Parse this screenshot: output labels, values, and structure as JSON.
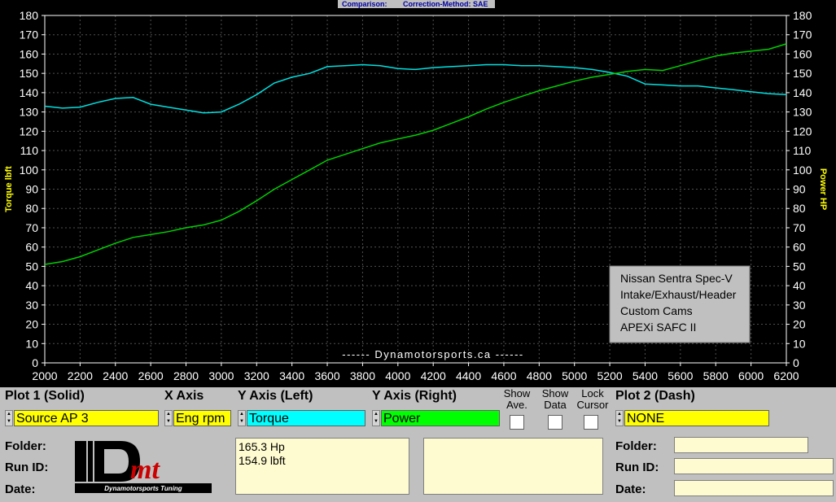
{
  "header": {
    "comparison_label": "Comparison:",
    "correction_label": "Correction-Method: SAE"
  },
  "chart_data": {
    "type": "line",
    "x": [
      2000,
      2100,
      2200,
      2300,
      2400,
      2500,
      2600,
      2700,
      2800,
      2900,
      3000,
      3100,
      3200,
      3300,
      3400,
      3500,
      3600,
      3700,
      3800,
      3900,
      4000,
      4100,
      4200,
      4300,
      4400,
      4500,
      4600,
      4700,
      4800,
      4900,
      5000,
      5100,
      5200,
      5300,
      5400,
      5500,
      5600,
      5700,
      5800,
      5900,
      6000,
      6100,
      6200
    ],
    "xlim": [
      2000,
      6200
    ],
    "ylim": [
      0,
      180
    ],
    "xticks": [
      2000,
      2200,
      2400,
      2600,
      2800,
      3000,
      3200,
      3400,
      3600,
      3800,
      4000,
      4200,
      4400,
      4600,
      4800,
      5000,
      5200,
      5400,
      5600,
      5800,
      6000,
      6200
    ],
    "yticks": [
      0,
      10,
      20,
      30,
      40,
      50,
      60,
      70,
      80,
      90,
      100,
      110,
      120,
      130,
      140,
      150,
      160,
      170,
      180
    ],
    "ylabel": "Torque lbft",
    "ylabel_right": "Power HP",
    "grid": true,
    "series": [
      {
        "name": "Torque",
        "color": "#00e0e0",
        "axis": "left",
        "values": [
          133,
          132,
          132.5,
          135,
          137,
          137.5,
          134,
          132.5,
          131,
          129.5,
          130,
          134,
          139,
          145,
          148,
          150,
          153.5,
          154,
          154.5,
          154,
          152.5,
          152,
          153,
          153.5,
          154,
          154.5,
          154.5,
          154,
          154,
          153.5,
          153,
          152,
          150.5,
          148.5,
          144.5,
          144,
          143.5,
          143.5,
          142.5,
          141.5,
          140.5,
          139.5,
          139
        ]
      },
      {
        "name": "Power",
        "color": "#00d000",
        "axis": "right",
        "values": [
          51,
          52.5,
          55,
          58.5,
          62,
          65,
          66.5,
          68,
          70,
          71.5,
          74,
          78.5,
          84,
          90,
          95,
          100,
          105,
          108,
          111,
          114,
          116,
          118,
          120.5,
          124,
          127.5,
          131.5,
          135,
          138,
          141,
          143.5,
          146,
          148,
          149.5,
          151,
          152,
          151.5,
          154,
          156.5,
          159,
          160.5,
          161.5,
          162.5,
          165.3
        ]
      }
    ]
  },
  "annotation": {
    "lines": [
      "Nissan Sentra Spec-V",
      "Intake/Exhaust/Header",
      "Custom Cams",
      "APEXi SAFC II"
    ],
    "watermark": "------  Dynamotorsports.ca  ------"
  },
  "controls": {
    "plot1_label": "Plot 1 (Solid)",
    "xaxis_label": "X Axis",
    "yleft_label": "Y Axis (Left)",
    "yright_label": "Y Axis (Right)",
    "show_ave_label": "Show Ave.",
    "show_data_label": "Show Data",
    "lock_cursor_label": "Lock Cursor",
    "plot2_label": "Plot 2 (Dash)",
    "plot1_value": "Source AP 3",
    "xaxis_value": "Eng rpm",
    "yleft_value": "Torque",
    "yright_value": "Power",
    "plot2_value": "NONE",
    "folder_label": "Folder:",
    "runid_label": "Run ID:",
    "date_label": "Date:",
    "readout_hp": "165.3 Hp",
    "readout_tq": "154.9 lbft",
    "logo_text": "Dmt",
    "logo_sub": "Dynamotorsports Tuning",
    "colors": {
      "plot1": "#ffff00",
      "xaxis": "#ffff00",
      "yleft": "#00ffff",
      "yright": "#00ff00",
      "plot2": "#ffff00"
    }
  }
}
